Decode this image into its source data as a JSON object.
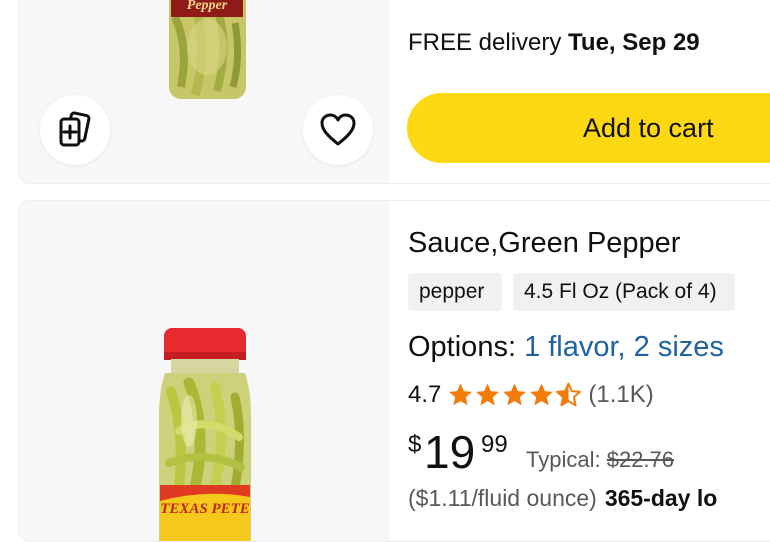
{
  "colors": {
    "cart_button": "#ffd814",
    "link": "#2162a1",
    "star": "#f17b0b",
    "muted_text": "#565959",
    "chip_bg": "#f0f2f2"
  },
  "product1": {
    "delivery_prefix": "FREE delivery",
    "delivery_date": "Tue, Sep 29",
    "add_to_cart_label": "Add to cart",
    "compare_icon": "compare-cards-icon",
    "wishlist_icon": "heart-icon",
    "jar_label_text": "Pepper"
  },
  "product2": {
    "title": "Sauce,Green Pepper",
    "chips": [
      "pepper",
      "4.5 Fl Oz (Pack of 4)"
    ],
    "options_label": "Options:",
    "options_value": "1 flavor, 2 sizes",
    "rating_value": "4.7",
    "rating_stars": 4.5,
    "rating_count": "(1.1K)",
    "price_symbol": "$",
    "price_whole": "19",
    "price_fraction": "99",
    "typical_label": "Typical:",
    "typical_price": "$22.76",
    "unit_price": "($1.11/fluid ounce)",
    "returns_text": "365-day lo",
    "jar_label_text": "TEXAS PETE"
  }
}
